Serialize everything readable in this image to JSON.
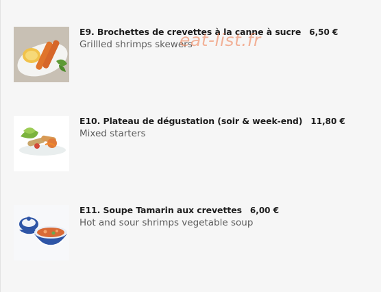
{
  "watermark": "eat-list.fr",
  "items": [
    {
      "name": "E9. Brochettes de crevettes à la canne à sucre",
      "price": "6,50 €",
      "desc": "Grillled shrimps skewers",
      "image": "shrimp-skewers-photo"
    },
    {
      "name": "E10. Plateau de dégustation (soir & week-end)",
      "price": "11,80 €",
      "desc": "Mixed starters",
      "image": "mixed-starters-photo"
    },
    {
      "name": "E11. Soupe Tamarin aux crevettes",
      "price": "6,00 €",
      "desc": "Hot and sour shrimps vegetable soup",
      "image": "tamarind-soup-photo"
    }
  ]
}
